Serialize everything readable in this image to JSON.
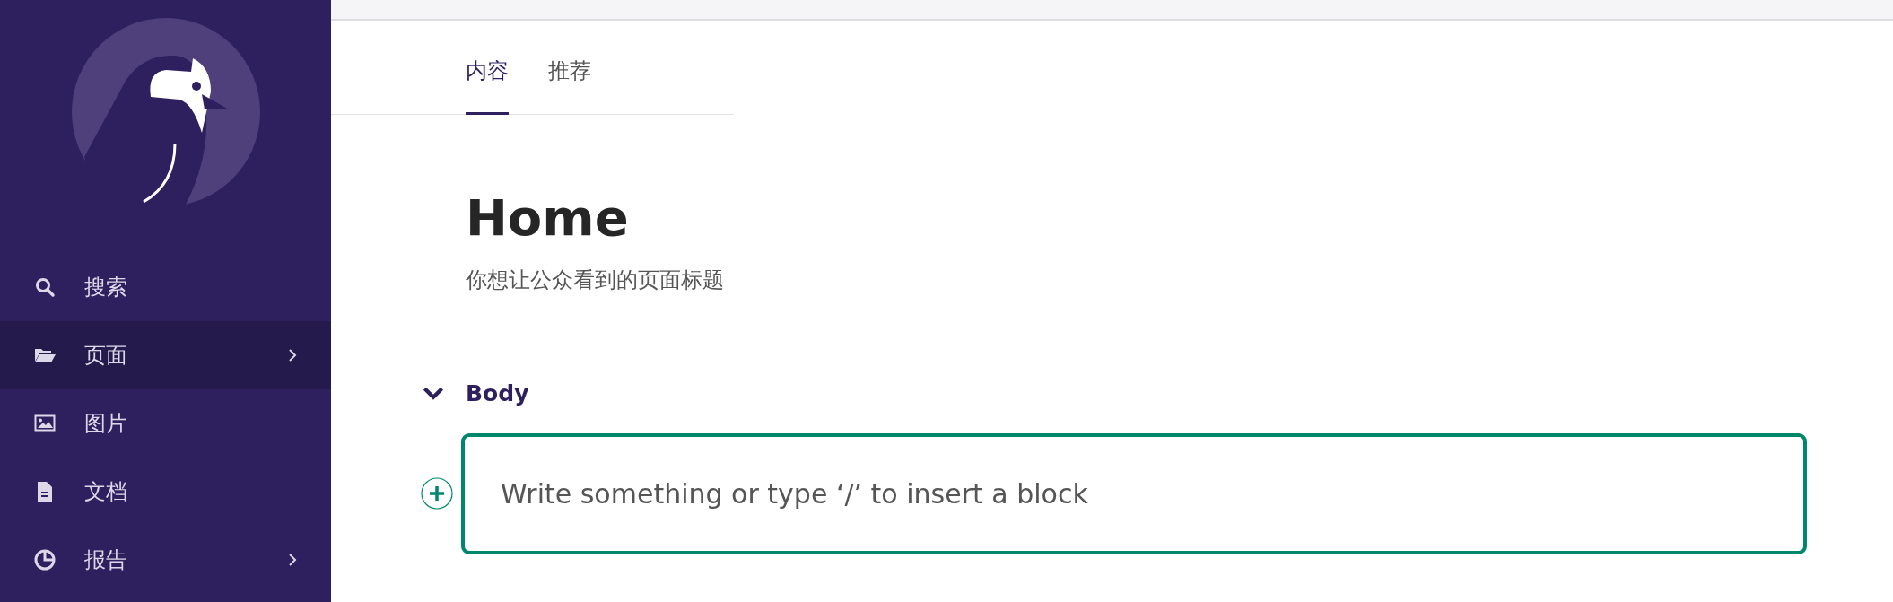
{
  "sidebar": {
    "items": [
      {
        "label": "搜索",
        "kind": "search",
        "selected": false,
        "expandable": false
      },
      {
        "label": "页面",
        "kind": "folder",
        "selected": true,
        "expandable": true
      },
      {
        "label": "图片",
        "kind": "image",
        "selected": false,
        "expandable": false
      },
      {
        "label": "文档",
        "kind": "document",
        "selected": false,
        "expandable": false
      },
      {
        "label": "报告",
        "kind": "chart",
        "selected": false,
        "expandable": true
      }
    ]
  },
  "tabs": [
    {
      "label": "内容",
      "selected": true
    },
    {
      "label": "推荐",
      "selected": false
    }
  ],
  "page": {
    "title": "Home",
    "subtitle": "你想让公众看到的页面标题"
  },
  "section": {
    "label": "Body",
    "expanded": true
  },
  "editor": {
    "placeholder": "Write something or type ‘/’ to insert a block"
  }
}
